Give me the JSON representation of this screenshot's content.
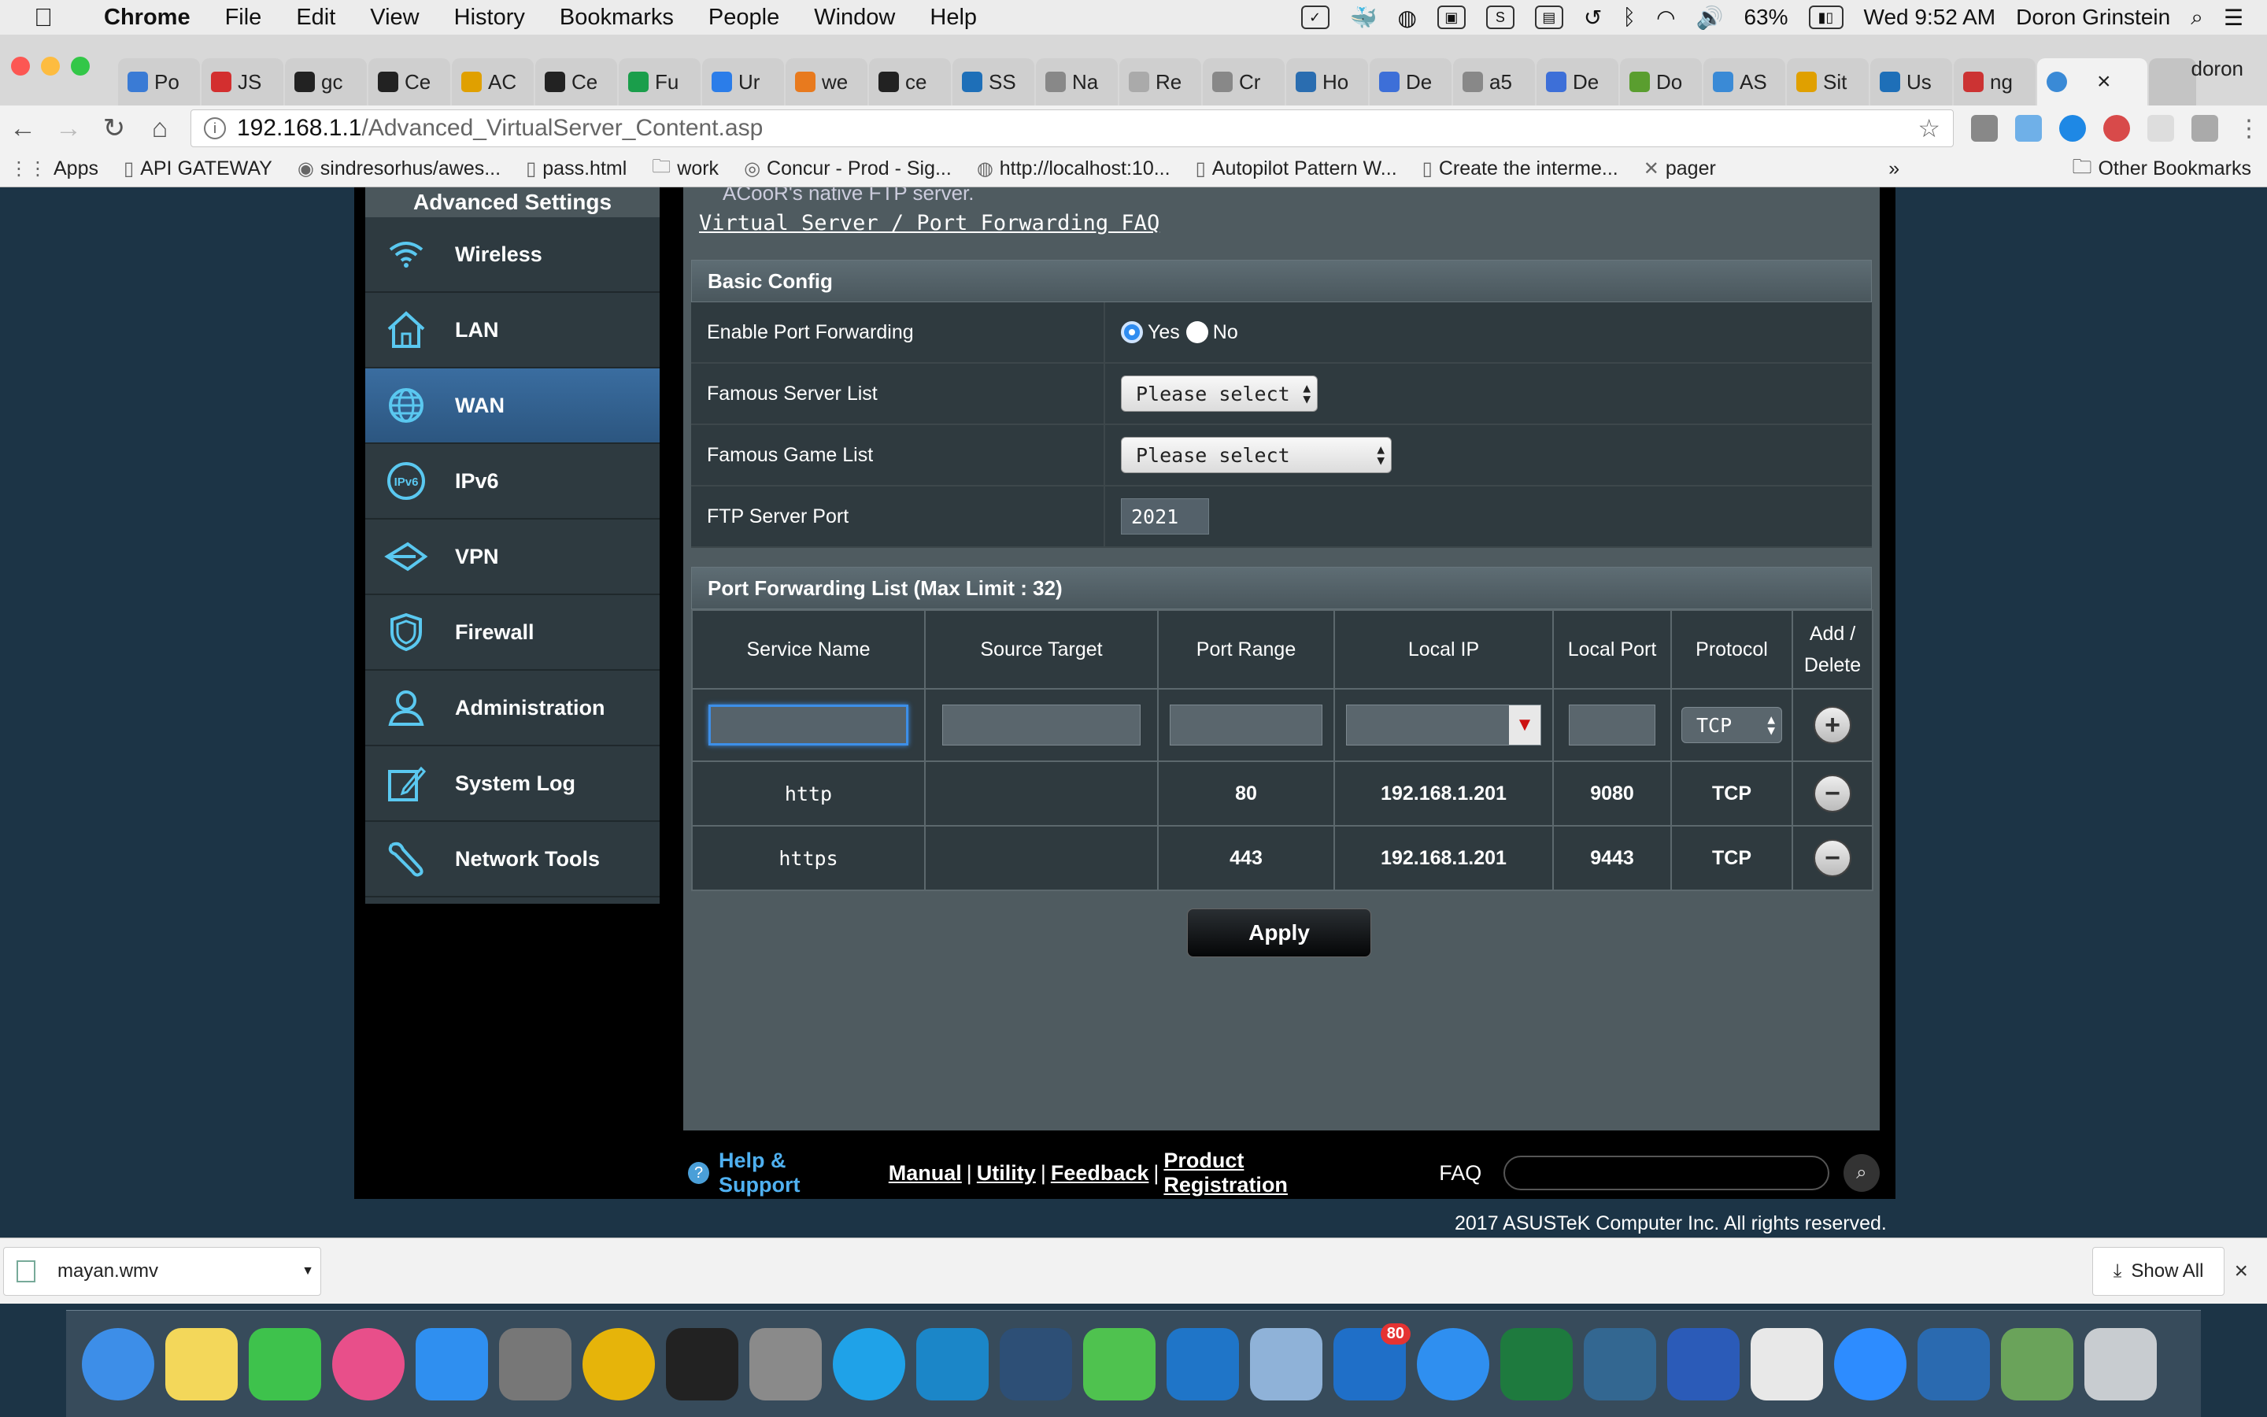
{
  "menubar": {
    "app_name": "Chrome",
    "items": [
      "File",
      "Edit",
      "View",
      "History",
      "Bookmarks",
      "People",
      "Window",
      "Help"
    ],
    "battery": "63%",
    "clock": "Wed 9:52 AM",
    "user": "Doron Grinstein"
  },
  "tabs": [
    {
      "label": "Po",
      "color": "#3a7bd5"
    },
    {
      "label": "JS",
      "color": "#d32f2f"
    },
    {
      "label": "gc",
      "color": "#222222"
    },
    {
      "label": "Ce",
      "color": "#222222"
    },
    {
      "label": "AC",
      "color": "#e0a000"
    },
    {
      "label": "Ce",
      "color": "#222222"
    },
    {
      "label": "Fu",
      "color": "#1a9e4b"
    },
    {
      "label": "Ur",
      "color": "#2b7de9"
    },
    {
      "label": "we",
      "color": "#e87a1e"
    },
    {
      "label": "ce",
      "color": "#222222"
    },
    {
      "label": "SS",
      "color": "#1e6fb8"
    },
    {
      "label": "Na",
      "color": "#888888"
    },
    {
      "label": "Re",
      "color": "#aaaaaa"
    },
    {
      "label": "Cr",
      "color": "#888888"
    },
    {
      "label": "Ho",
      "color": "#2a6db0"
    },
    {
      "label": "De",
      "color": "#3d6fd8"
    },
    {
      "label": "a5",
      "color": "#888888"
    },
    {
      "label": "De",
      "color": "#3d6fd8"
    },
    {
      "label": "Do",
      "color": "#5a9e2f"
    },
    {
      "label": "AS",
      "color": "#3a8ad6"
    },
    {
      "label": "Sit",
      "color": "#e0a000"
    },
    {
      "label": "Us",
      "color": "#1e6fb8"
    },
    {
      "label": "ng",
      "color": "#cc3333"
    }
  ],
  "active_tab_close": "×",
  "profile_name": "doron",
  "address": {
    "host": "192.168.1.1",
    "path": "/Advanced_VirtualServer_Content.asp"
  },
  "bookmarks": [
    {
      "label": "Apps",
      "icon": "apps-grid-icon"
    },
    {
      "label": "API GATEWAY",
      "icon": "page-icon"
    },
    {
      "label": "sindresorhus/awes...",
      "icon": "github-icon"
    },
    {
      "label": "pass.html",
      "icon": "page-icon"
    },
    {
      "label": "work",
      "icon": "folder-icon"
    },
    {
      "label": "Concur - Prod - Sig...",
      "icon": "concur-icon"
    },
    {
      "label": "http://localhost:10...",
      "icon": "globe-icon"
    },
    {
      "label": "Autopilot Pattern W...",
      "icon": "page-icon"
    },
    {
      "label": "Create the interme...",
      "icon": "page-icon"
    },
    {
      "label": "pager",
      "icon": "pager-icon"
    }
  ],
  "bookmarks_overflow": "»",
  "other_bookmarks": "Other Bookmarks",
  "sidebar": {
    "title": "Advanced Settings",
    "items": [
      {
        "label": "Wireless",
        "icon": "wifi-icon",
        "active": false
      },
      {
        "label": "LAN",
        "icon": "home-icon",
        "active": false
      },
      {
        "label": "WAN",
        "icon": "globe-icon",
        "active": true
      },
      {
        "label": "IPv6",
        "icon": "ipv6-icon",
        "active": false
      },
      {
        "label": "VPN",
        "icon": "vpn-icon",
        "active": false
      },
      {
        "label": "Firewall",
        "icon": "shield-icon",
        "active": false
      },
      {
        "label": "Administration",
        "icon": "user-icon",
        "active": false
      },
      {
        "label": "System Log",
        "icon": "edit-log-icon",
        "active": false
      },
      {
        "label": "Network Tools",
        "icon": "tools-icon",
        "active": false
      }
    ]
  },
  "content": {
    "note": "ACooR's native FTP server.",
    "faq_link": "Virtual Server / Port Forwarding FAQ",
    "basic_config": {
      "title": "Basic Config",
      "enable_label": "Enable Port Forwarding",
      "yes_label": "Yes",
      "no_label": "No",
      "famous_server_label": "Famous Server List",
      "famous_server_value": "Please select",
      "famous_game_label": "Famous Game List",
      "famous_game_value": "Please select",
      "ftp_port_label": "FTP Server Port",
      "ftp_port_value": "2021"
    },
    "port_list": {
      "title": "Port Forwarding List (Max Limit : 32)",
      "headers": [
        "Service Name",
        "Source Target",
        "Port Range",
        "Local IP",
        "Local Port",
        "Protocol",
        "Add / Delete"
      ],
      "new_protocol": "TCP",
      "rows": [
        {
          "service": "http",
          "source": "",
          "port_range": "80",
          "local_ip": "192.168.1.201",
          "local_port": "9080",
          "protocol": "TCP"
        },
        {
          "service": "https",
          "source": "",
          "port_range": "443",
          "local_ip": "192.168.1.201",
          "local_port": "9443",
          "protocol": "TCP"
        }
      ]
    },
    "apply_label": "Apply"
  },
  "footer": {
    "help": "Help & Support",
    "links": [
      "Manual",
      "Utility",
      "Feedback",
      "Product Registration"
    ],
    "faq_label": "FAQ",
    "copyright": "2017 ASUSTeK Computer Inc. All rights reserved."
  },
  "downloads": {
    "file": "mayan.wmv",
    "show_all": "Show All",
    "close": "×"
  },
  "dock": [
    {
      "name": "finder",
      "color": "#3d8ee8"
    },
    {
      "name": "notes",
      "color": "#f3d75a"
    },
    {
      "name": "facetime",
      "color": "#3ec24c"
    },
    {
      "name": "itunes",
      "color": "#e84f8a"
    },
    {
      "name": "app-store",
      "color": "#2f8ff0"
    },
    {
      "name": "system-preferences",
      "color": "#777777"
    },
    {
      "name": "chrome",
      "color": "#e6b40a"
    },
    {
      "name": "terminal",
      "color": "#222222"
    },
    {
      "name": "calculator",
      "color": "#8a8a8a"
    },
    {
      "name": "skype",
      "color": "#1fa2e8"
    },
    {
      "name": "webstorm",
      "color": "#1b86c8"
    },
    {
      "name": "mysql-workbench",
      "color": "#2d4f76"
    },
    {
      "name": "sourcetree",
      "color": "#4fc24f"
    },
    {
      "name": "vscode",
      "color": "#1f75c8"
    },
    {
      "name": "preview",
      "color": "#8fb2d8"
    },
    {
      "name": "outlook",
      "color": "#1f6fc8",
      "badge": "80"
    },
    {
      "name": "safari",
      "color": "#2f8ff0"
    },
    {
      "name": "excel",
      "color": "#1e7a3e"
    },
    {
      "name": "pgadmin",
      "color": "#336791"
    },
    {
      "name": "word",
      "color": "#2b5bb8"
    },
    {
      "name": "slack",
      "color": "#e8e8e8"
    },
    {
      "name": "zoom",
      "color": "#2d8cff"
    },
    {
      "name": "sophos",
      "color": "#2a6ab0"
    },
    {
      "name": "network-utility",
      "color": "#6aa35a"
    },
    {
      "name": "trash",
      "color": "#c8ccd0"
    }
  ]
}
